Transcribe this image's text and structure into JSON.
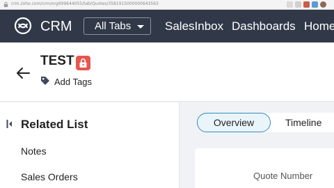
{
  "browser": {
    "url": "crm.zoho.com/crm/org699644055/tab/Quotes/3581915000000643563"
  },
  "topnav": {
    "brand": "CRM",
    "all_tabs_label": "All Tabs",
    "links": [
      "SalesInbox",
      "Dashboards",
      "Home"
    ]
  },
  "record": {
    "title": "TEST",
    "add_tags_label": "Add Tags"
  },
  "related_list": {
    "title": "Related List",
    "items": [
      "Notes",
      "Sales Orders"
    ]
  },
  "tabs": {
    "overview": "Overview",
    "timeline": "Timeline"
  },
  "details": {
    "quote_number_label": "Quote Number"
  },
  "colors": {
    "nav_bg": "#313949",
    "accent": "#2f8fbd",
    "lock_badge": "#e8554e"
  }
}
